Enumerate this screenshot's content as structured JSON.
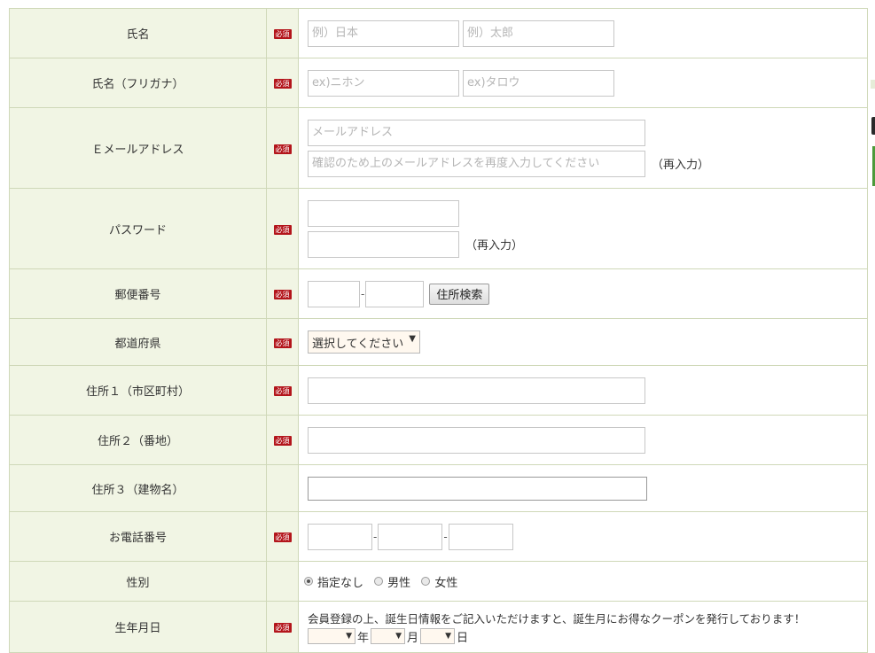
{
  "required_badge": "必須",
  "name": {
    "label": "氏名",
    "last_placeholder": "例）日本",
    "first_placeholder": "例）太郎"
  },
  "name_kana": {
    "label": "氏名（フリガナ）",
    "last_placeholder": "ex)ニホン",
    "first_placeholder": "ex)タロウ"
  },
  "email": {
    "label": "Ｅメールアドレス",
    "placeholder": "メールアドレス",
    "confirm_placeholder": "確認のため上のメールアドレスを再度入力してください",
    "reenter_note": "（再入力）"
  },
  "password": {
    "label": "パスワード",
    "reenter_note": "（再入力）"
  },
  "postal": {
    "label": "郵便番号",
    "separator": "-",
    "search_button": "住所検索"
  },
  "prefecture": {
    "label": "都道府県",
    "selected": "選択してください",
    "arrow": "▼"
  },
  "address1": {
    "label": "住所１（市区町村）"
  },
  "address2": {
    "label": "住所２（番地）"
  },
  "address3": {
    "label": "住所３（建物名）"
  },
  "phone": {
    "label": "お電話番号",
    "separator": "-"
  },
  "gender": {
    "label": "性別",
    "options": [
      "指定なし",
      "男性",
      "女性"
    ],
    "selected_index": 0
  },
  "birthday": {
    "label": "生年月日",
    "note": "会員登録の上、誕生日情報をご記入いただけますと、誕生月にお得なクーポンを発行しております！",
    "arrow": "▼",
    "year_unit": "年",
    "month_unit": "月",
    "day_unit": "日"
  }
}
